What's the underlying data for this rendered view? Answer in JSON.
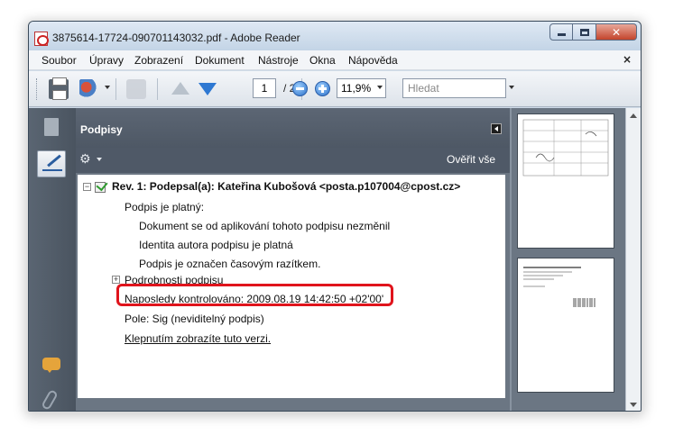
{
  "window": {
    "title": "3875614-17724-090701143032.pdf - Adobe Reader",
    "close_glyph": "✕"
  },
  "menu": {
    "items": [
      "Soubor",
      "Úpravy",
      "Zobrazení",
      "Dokument",
      "Nástroje",
      "Okna",
      "Nápověda"
    ],
    "close_glyph": "×"
  },
  "toolbar": {
    "page_current": "1",
    "page_total": "/ 2",
    "zoom": "11,9%",
    "search_placeholder": "Hledat"
  },
  "signatures_panel": {
    "title": "Podpisy",
    "verify_all": "Ověřit vše",
    "gear_glyph": "⚙",
    "items": {
      "header": "Rev. 1: Podepsal(a): Kateřina Kubošová <posta.p107004@cpost.cz>",
      "validity": "Podpis je platný:",
      "detail_unchanged": "Dokument se od aplikování tohoto podpisu nezměnil",
      "detail_identity": "Identita autora podpisu je platná",
      "detail_timestamp": "Podpis je označen časovým razítkem.",
      "details": "Podrobnosti podpisu",
      "last_checked": "Naposledy kontrolováno: 2009.08.19 14:42:50 +02'00'",
      "field": "Pole: Sig (neviditelný podpis)",
      "view_version": "Klepnutím zobrazíte tuto verzi."
    }
  },
  "colors": {
    "highlight": "#e0141c",
    "panel_dark": "#4f5967",
    "accent_blue": "#2e78d2"
  },
  "icons": [
    "pdf-icon",
    "printer-icon",
    "collaborate-icon",
    "sign-icon",
    "previous-page-icon",
    "next-page-icon",
    "zoom-out-icon",
    "zoom-in-icon",
    "pages-icon",
    "signature-icon",
    "comments-icon",
    "attachment-icon",
    "gear-icon"
  ]
}
